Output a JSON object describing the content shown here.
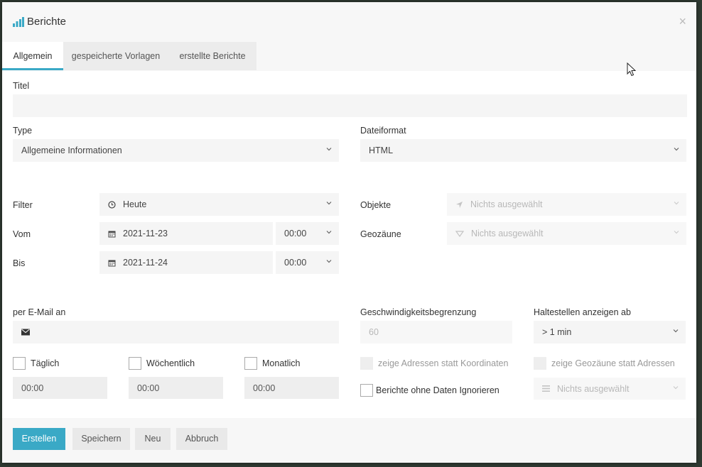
{
  "window": {
    "title": "Berichte",
    "close_symbol": "×"
  },
  "tabs": [
    {
      "label": "Allgemein",
      "active": true
    },
    {
      "label": "gespeicherte Vorlagen",
      "active": false
    },
    {
      "label": "erstellte Berichte",
      "active": false
    }
  ],
  "form": {
    "title_label": "Titel",
    "title_value": "",
    "type_label": "Type",
    "type_value": "Allgemeine Informationen",
    "format_label": "Dateiformat",
    "format_value": "HTML",
    "filter_label": "Filter",
    "filter_value": "Heute",
    "from_label": "Vom",
    "from_date": "2021-11-23",
    "from_time": "00:00",
    "to_label": "Bis",
    "to_date": "2021-11-24",
    "to_time": "00:00",
    "objects_label": "Objekte",
    "objects_value": "Nichts ausgewählt",
    "geofences_label": "Geozäune",
    "geofences_value": "Nichts ausgewählt",
    "email_label": "per E-Mail an",
    "email_value": "",
    "speed_label": "Geschwindigkeitsbegrenzung",
    "speed_value": "60",
    "stops_label": "Haltestellen anzeigen ab",
    "stops_value": "> 1 min",
    "daily_label": "Täglich",
    "daily_time": "00:00",
    "weekly_label": "Wöchentlich",
    "weekly_time": "00:00",
    "monthly_label": "Monatlich",
    "monthly_time": "00:00",
    "show_addresses_label": "zeige Adressen statt Koordinaten",
    "show_geofences_label": "zeige Geozäune statt Adressen",
    "ignore_empty_label": "Berichte ohne Daten Ignorieren",
    "extra_select_value": "Nichts ausgewählt"
  },
  "buttons": {
    "create": "Erstellen",
    "save": "Speichern",
    "new": "Neu",
    "cancel": "Abbruch"
  },
  "colors": {
    "accent": "#3aa9c6"
  },
  "icons": [
    "bar-chart-icon",
    "close-icon",
    "chevron-down-icon",
    "clock-icon",
    "calendar-icon",
    "location-arrow-icon",
    "geofence-icon",
    "envelope-icon",
    "list-icon",
    "mouse-cursor-icon"
  ]
}
